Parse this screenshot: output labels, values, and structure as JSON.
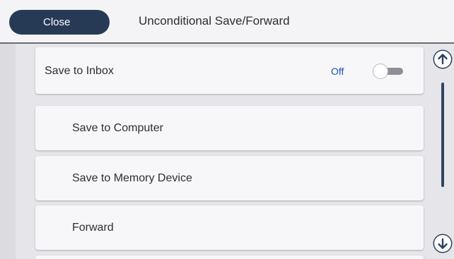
{
  "header": {
    "close_label": "Close",
    "title": "Unconditional Save/Forward"
  },
  "rows": {
    "save_to_inbox": {
      "label": "Save to Inbox",
      "state_label": "Off",
      "toggle_on": false
    },
    "items": [
      {
        "label": "Save to Computer"
      },
      {
        "label": "Save to Memory Device"
      },
      {
        "label": "Forward"
      }
    ]
  },
  "scrollbar": {
    "up_icon": "arrow-up-icon",
    "down_icon": "arrow-down-icon"
  },
  "colors": {
    "close_button": "#263a56",
    "toggle_state_text": "#1e4fb4",
    "scroll_accent": "#2f4466"
  }
}
